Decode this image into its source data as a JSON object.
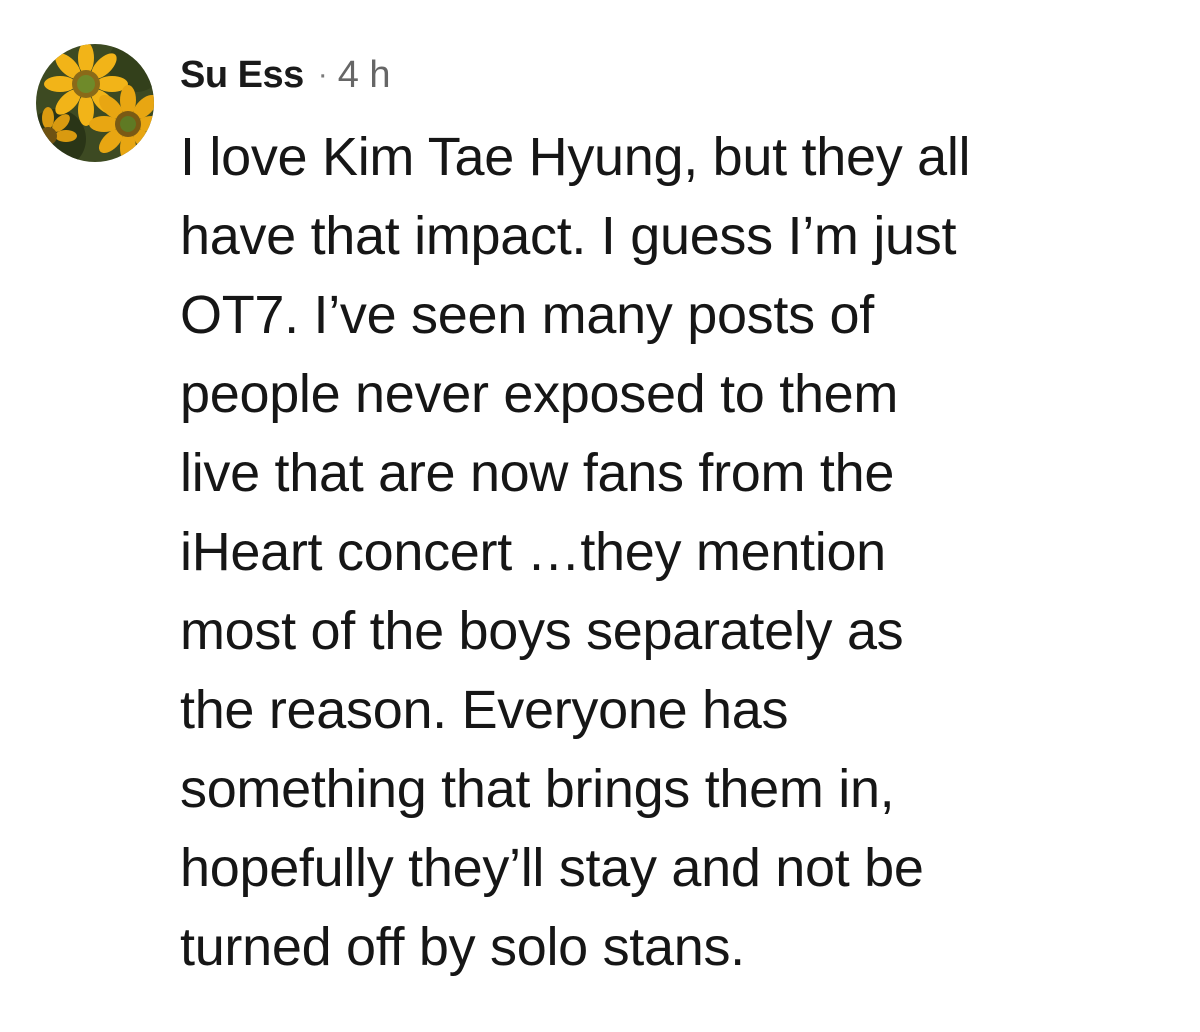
{
  "comment": {
    "avatar_icon": "sunflower-avatar-icon",
    "author": "Su Ess",
    "separator": "·",
    "timestamp": "4 h",
    "lines": [
      "I love Kim Tae Hyung, but they all",
      "have that impact. I guess I’m just",
      "OT7. I’ve seen many posts of",
      "people never exposed to them",
      "live that are now fans from the",
      "iHeart concert …they mention",
      "most of the boys separately as",
      "the reason. Everyone has",
      "something that brings them in,",
      "hopefully they’ll stay and not be",
      "turned off by solo stans."
    ]
  },
  "colors": {
    "background": "#ffffff",
    "text": "#161616",
    "meta": "#666666"
  }
}
